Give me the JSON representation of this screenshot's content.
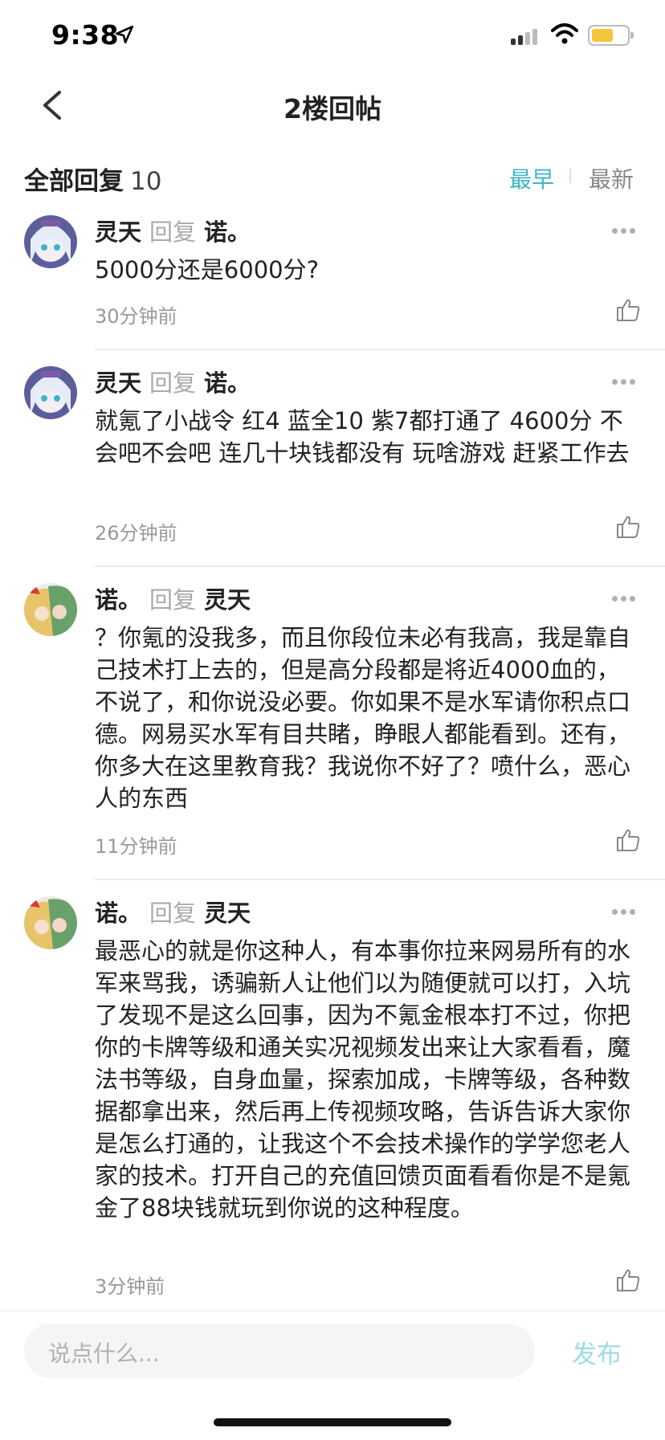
{
  "status": {
    "time": "9:38"
  },
  "nav": {
    "title": "2楼回帖"
  },
  "header": {
    "total_label": "全部回复",
    "total_count": "10",
    "earliest": "最早",
    "latest": "最新"
  },
  "replies": [
    {
      "user": "灵天",
      "reply_word": "回复",
      "target": "诺。",
      "content": "5000分还是6000分?",
      "time": "30分钟前",
      "avatar": "anime-girl-white-hair"
    },
    {
      "user": "灵天",
      "reply_word": "回复",
      "target": "诺。",
      "content": "就氪了小战令 红4  蓝全10  紫7都打通了  4600分 不会吧不会吧 连几十块钱都没有 玩啥游戏 赶紧工作去",
      "time": "26分钟前",
      "avatar": "anime-girl-white-hair"
    },
    {
      "user": "诺。",
      "reply_word": "回复",
      "target": "灵天",
      "content": "？你氪的没我多，而且你段位未必有我高，我是靠自己技术打上去的，但是高分段都是将近4000血的，不说了，和你说没必要。你如果不是水军请你积点口德。网易买水军有目共睹，睁眼人都能看到。还有，你多大在这里教育我？我说你不好了？喷什么，恶心人的东西",
      "time": "11分钟前",
      "avatar": "anime-couple"
    },
    {
      "user": "诺。",
      "reply_word": "回复",
      "target": "灵天",
      "content": "最恶心的就是你这种人，有本事你拉来网易所有的水军来骂我，诱骗新人让他们以为随便就可以打，入坑了发现不是这么回事，因为不氪金根本打不过，你把你的卡牌等级和通关实况视频发出来让大家看看，魔法书等级，自身血量，探索加成，卡牌等级，各种数据都拿出来，然后再上传视频攻略，告诉告诉大家你是怎么打通的，让我这个不会技术操作的学学您老人家的技术。打开自己的充值回馈页面看看你是不是氪金了88块钱就玩到你说的这种程度。",
      "time": "3分钟前",
      "avatar": "anime-couple"
    }
  ],
  "composer": {
    "placeholder": "说点什么...",
    "publish": "发布"
  },
  "colors": {
    "accent": "#3eb6c8",
    "publish_disabled": "#9fdce6"
  }
}
